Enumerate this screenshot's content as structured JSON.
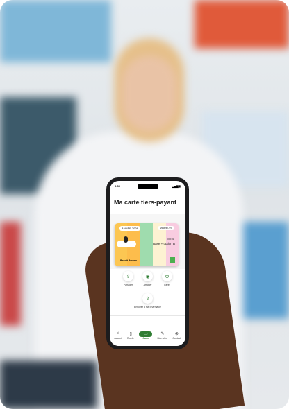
{
  "status": {
    "time": "9:39"
  },
  "header": {
    "title": "Ma carte tiers-payant"
  },
  "card": {
    "year": "ANNÉE 2026",
    "number": "292697774",
    "offer_label": "OFFRE",
    "offer": "Base + option B",
    "holder": "Benoit Broose",
    "stripe_colors": [
      "#fcc652",
      "#fdbd4c",
      "#9fdcae",
      "#fdf2d2",
      "#f8cce0"
    ]
  },
  "actions": [
    {
      "label": "Partager",
      "icon": "share-icon"
    },
    {
      "label": "Afficher",
      "icon": "eye-icon"
    },
    {
      "label": "Gérer",
      "icon": "gear-icon"
    }
  ],
  "send": {
    "label": "Envoyer à ma pharmacie",
    "icon": "share-icon"
  },
  "nav": [
    {
      "label": "Accueil",
      "icon": "home-icon"
    },
    {
      "label": "Remb.",
      "icon": "document-icon"
    },
    {
      "label": "Carte",
      "icon": "card-icon",
      "active": true
    },
    {
      "label": "Mon offre",
      "icon": "offer-icon"
    },
    {
      "label": "Contact",
      "icon": "contact-icon"
    }
  ],
  "accent": "#2e7d32"
}
